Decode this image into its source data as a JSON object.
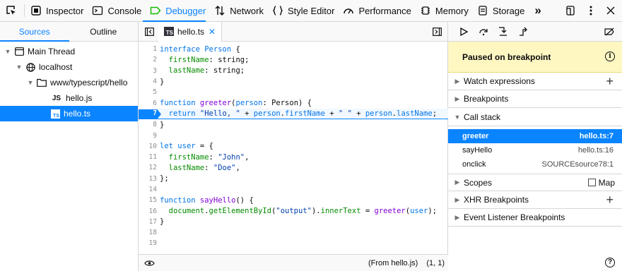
{
  "toolbar": {
    "tabs": [
      "Inspector",
      "Console",
      "Debugger",
      "Network",
      "Style Editor",
      "Performance",
      "Memory",
      "Storage"
    ],
    "more": "»"
  },
  "sources": {
    "tabs": [
      "Sources",
      "Outline"
    ],
    "tree": [
      {
        "label": "Main Thread"
      },
      {
        "label": "localhost"
      },
      {
        "label": "www/typescript/hello"
      },
      {
        "label": "hello.js",
        "badge": "JS"
      },
      {
        "label": "hello.ts",
        "badge": "TS"
      }
    ]
  },
  "editor": {
    "tab_label": "hello.ts",
    "ts_badge": "TS",
    "close": "✕",
    "lines": [
      {
        "n": "1"
      },
      {
        "n": "2"
      },
      {
        "n": "3"
      },
      {
        "n": "4"
      },
      {
        "n": "5"
      },
      {
        "n": "6"
      },
      {
        "n": "7"
      },
      {
        "n": "8"
      },
      {
        "n": "9"
      },
      {
        "n": "10"
      },
      {
        "n": "11"
      },
      {
        "n": "12"
      },
      {
        "n": "13"
      },
      {
        "n": "14"
      },
      {
        "n": "15"
      },
      {
        "n": "16"
      },
      {
        "n": "17"
      },
      {
        "n": "18"
      },
      {
        "n": "19"
      }
    ],
    "code": {
      "l1a": "interface",
      "l1b": "Person",
      "l1c": " {",
      "l2a": "  firstName",
      "l2b": ": string;",
      "l3a": "  lastName",
      "l3b": ": string;",
      "l4": "}",
      "l6a": "function",
      "l6b": "greeter",
      "l6c": "(",
      "l6d": "person",
      "l6e": ": Person) {",
      "l7a": "  return",
      "l7b": "\"Hello, \"",
      "l7c": " + ",
      "l7d": "person",
      "l7e": ".",
      "l7f": "firstName",
      "l7g": " + ",
      "l7h": "\" \"",
      "l7i": " + ",
      "l7j": "person",
      "l7k": ".",
      "l7l": "lastName",
      "l7m": ";",
      "l8": "}",
      "l10a": "let",
      "l10b": "user",
      "l10c": " = {",
      "l11a": "  firstName",
      "l11b": ": ",
      "l11c": "\"John\"",
      "l11d": ",",
      "l12a": "  lastName",
      "l12b": ": ",
      "l12c": "\"Doe\"",
      "l12d": ",",
      "l13": "};",
      "l15a": "function",
      "l15b": "sayHello",
      "l15c": "() {",
      "l16a": "  document",
      "l16b": ".",
      "l16c": "getElementById",
      "l16d": "(",
      "l16e": "\"output\"",
      "l16f": ").",
      "l16g": "innerText",
      "l16h": " = ",
      "l16i": "greeter",
      "l16j": "(",
      "l16k": "user",
      "l16l": ");",
      "l17": "}"
    },
    "footer_source": "(From hello.js)",
    "footer_pos": "(1, 1)"
  },
  "debugger": {
    "paused": "Paused on breakpoint",
    "info": "i",
    "sections": {
      "watch": "Watch expressions",
      "breakpoints": "Breakpoints",
      "callstack": "Call stack",
      "scopes": "Scopes",
      "map": "Map",
      "xhr": "XHR Breakpoints",
      "event": "Event Listener Breakpoints"
    },
    "frames": [
      {
        "name": "greeter",
        "loc": "hello.ts:7"
      },
      {
        "name": "sayHello",
        "loc": "hello.ts:16"
      },
      {
        "name": "onclick",
        "loc": "SOURCEsource78:1"
      }
    ],
    "help": "?"
  }
}
